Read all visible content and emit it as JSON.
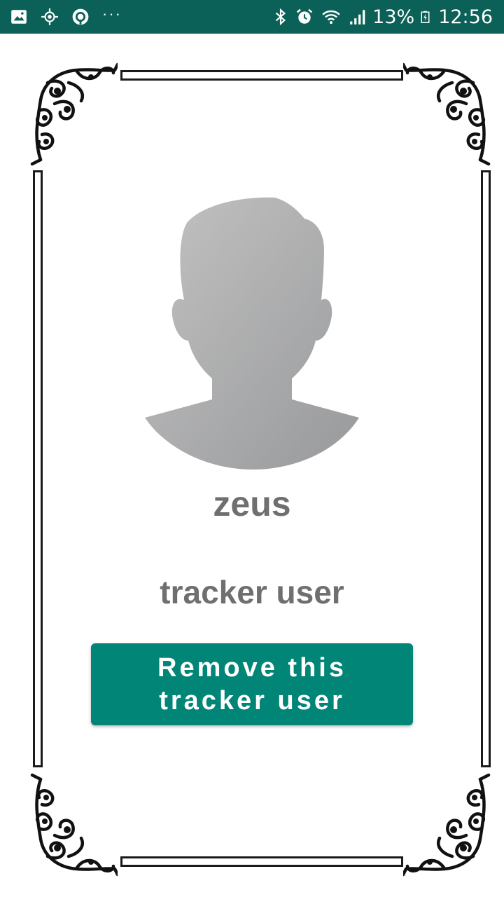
{
  "status_bar": {
    "icons_left": [
      "image-icon",
      "location-icon",
      "sync-icon",
      "more-icon"
    ],
    "more_dots": "···",
    "icons_right": [
      "bluetooth-icon",
      "alarm-icon",
      "wifi-icon",
      "signal-icon",
      "battery-icon"
    ],
    "battery_percent": "13%",
    "time": "12:56",
    "background_color": "#0b6157"
  },
  "profile": {
    "avatar": "person-silhouette-icon",
    "name": "zeus",
    "role": "tracker user"
  },
  "actions": {
    "remove_button_label": "Remove this tracker user",
    "accent_color": "#008577"
  },
  "decoration": {
    "frame_corners": "ornamental-corner-icon"
  }
}
